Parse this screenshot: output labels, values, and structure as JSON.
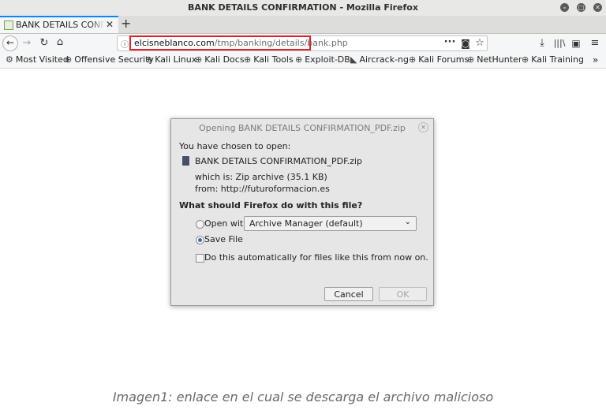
{
  "window": {
    "title": "BANK DETAILS CONFIRMATION - Mozilla Firefox"
  },
  "tab": {
    "title": "BANK DETAILS CONFIRMATION",
    "close_glyph": "✕"
  },
  "new_tab_glyph": "+",
  "url": {
    "domain": "elcisneblanco.com",
    "path": "/tmp/banking/details/bank.php"
  },
  "nav_icons": [
    "back-icon",
    "forward-icon",
    "reload-icon",
    "home-icon",
    "info-icon",
    "page-actions-icon",
    "pocket-icon",
    "bookmark-star-icon",
    "download-icon",
    "library-icon",
    "sidebar-icon",
    "menu-icon"
  ],
  "bookmarks": [
    {
      "label": "Most Visited",
      "icon": "gear-icon"
    },
    {
      "label": "Offensive Security",
      "icon": "globe-icon"
    },
    {
      "label": "Kali Linux",
      "icon": "globe-icon"
    },
    {
      "label": "Kali Docs",
      "icon": "globe-icon"
    },
    {
      "label": "Kali Tools",
      "icon": "globe-icon"
    },
    {
      "label": "Exploit-DB",
      "icon": "globe-icon"
    },
    {
      "label": "Aircrack-ng",
      "icon": "aircrack-icon"
    },
    {
      "label": "Kali Forums",
      "icon": "globe-icon"
    },
    {
      "label": "NetHunter",
      "icon": "globe-icon"
    },
    {
      "label": "Kali Training",
      "icon": "globe-icon"
    }
  ],
  "dialog": {
    "title": "Opening BANK DETAILS CONFIRMATION_PDF.zip",
    "intro": "You have chosen to open:",
    "filename": "BANK DETAILS CONFIRMATION_PDF.zip",
    "which_is": "which is:  Zip archive (35.1 KB)",
    "from": "from:  http://futuroformacion.es",
    "question": "What should Firefox do with this file?",
    "open_with_label": "Open with",
    "open_with_app": "Archive Manager (default)",
    "save_file_label": "Save File",
    "selected_option": "save-file",
    "auto_label": "Do this automatically for files like this from now on.",
    "auto_checked": false,
    "cancel_label": "Cancel",
    "ok_label": "OK",
    "ok_enabled": false
  },
  "caption": "Imagen1: enlace en el cual se descarga el archivo malicioso"
}
